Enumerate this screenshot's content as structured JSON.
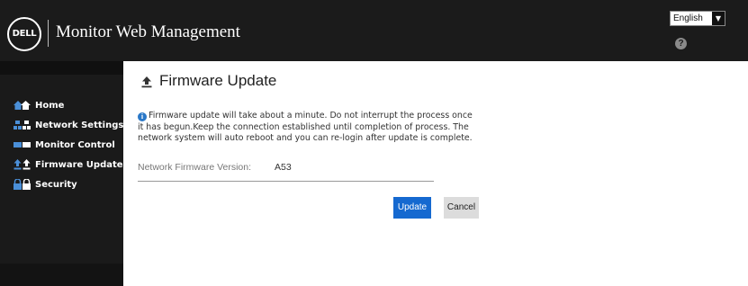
{
  "header": {
    "logo_text": "DELL",
    "app_title": "Monitor Web Management",
    "language": {
      "selected": "English"
    },
    "help_icon": "help-icon"
  },
  "sidebar": {
    "items": [
      {
        "label": "Home",
        "icon": "home-icon"
      },
      {
        "label": "Network Settings",
        "icon": "network-icon"
      },
      {
        "label": "Monitor Control",
        "icon": "monitor-icon"
      },
      {
        "label": "Firmware Update",
        "icon": "upload-icon"
      },
      {
        "label": "Security",
        "icon": "lock-icon"
      }
    ]
  },
  "main": {
    "title": "Firmware Update",
    "info_message": "Firmware update will take about a minute. Do not interrupt the process once it has begun.Keep the connection established until completion of process. The network system will auto reboot and you can re-login after update is complete.",
    "firmware_label": "Network Firmware Version:",
    "firmware_version": "A53",
    "update_button": "Update",
    "cancel_button": "Cancel"
  },
  "colors": {
    "header_bg": "#1b1b1b",
    "sidebar_bg": "#1a1a1a",
    "accent_blue": "#1569d0",
    "info_blue": "#2a78c8"
  }
}
